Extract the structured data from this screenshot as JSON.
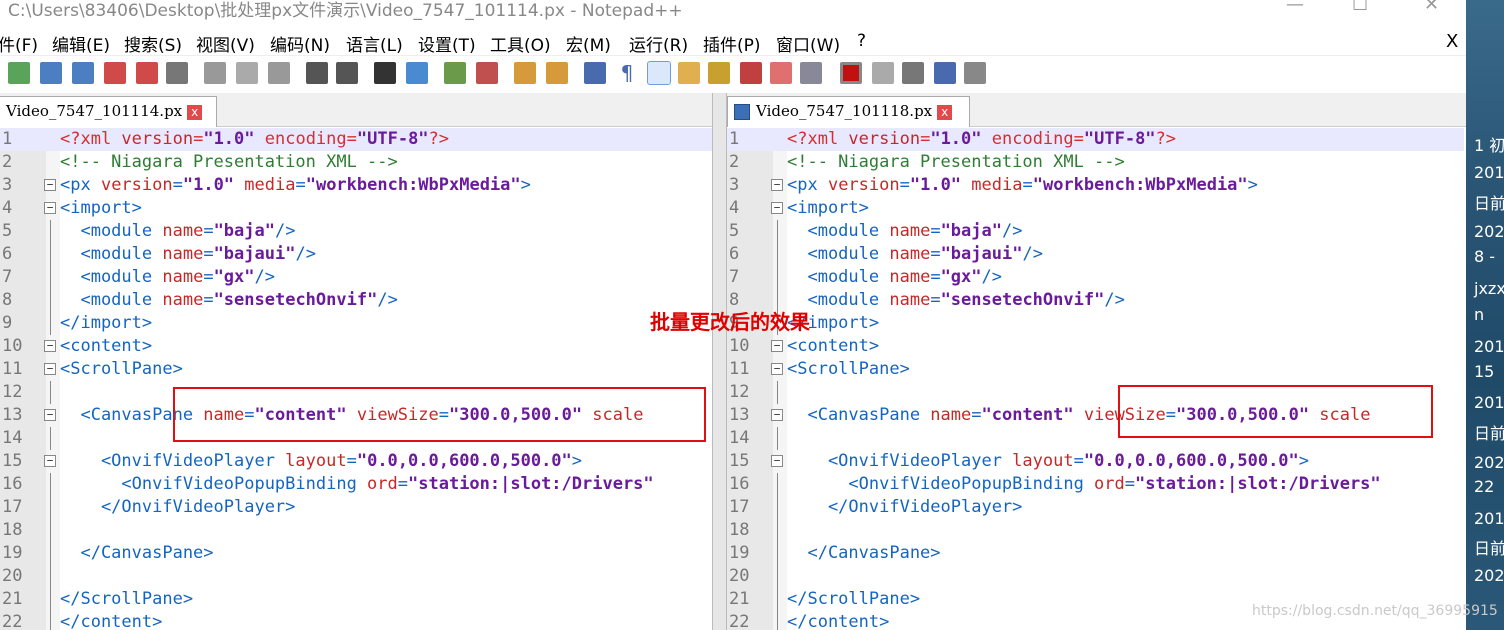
{
  "window": {
    "title": "C:\\Users\\83406\\Desktop\\批处理px文件演示\\Video_7547_101114.px - Notepad++",
    "minimize": "—",
    "maximize": "☐",
    "close": "✕"
  },
  "menu": {
    "items": [
      "件(F)",
      "编辑(E)",
      "搜索(S)",
      "视图(V)",
      "编码(N)",
      "语言(L)",
      "设置(T)",
      "工具(O)",
      "宏(M)",
      "运行(R)",
      "插件(P)",
      "窗口(W)",
      "?"
    ],
    "close": "X"
  },
  "tabs": {
    "left": "Video_7547_101114.px",
    "right": "Video_7547_101118.px",
    "close": "x"
  },
  "editor": {
    "line_numbers": [
      "1",
      "2",
      "3",
      "4",
      "5",
      "6",
      "7",
      "8",
      "9",
      "10",
      "11",
      "12",
      "13",
      "14",
      "15",
      "16",
      "17",
      "18",
      "19",
      "20",
      "21",
      "22"
    ],
    "lines": [
      [
        {
          "t": "pi",
          "s": "<?xml "
        },
        {
          "t": "attr",
          "s": "version"
        },
        {
          "t": "pi",
          "s": "="
        },
        {
          "t": "val",
          "s": "\"1.0\""
        },
        {
          "t": "pi",
          "s": " encoding"
        },
        {
          "t": "pi",
          "s": "="
        },
        {
          "t": "val",
          "s": "\"UTF-8\""
        },
        {
          "t": "pi",
          "s": "?>"
        }
      ],
      [
        {
          "t": "cm",
          "s": "<!-- Niagara Presentation XML -->"
        }
      ],
      [
        {
          "t": "tag",
          "s": "<px "
        },
        {
          "t": "attr",
          "s": "version"
        },
        {
          "t": "tag",
          "s": "="
        },
        {
          "t": "val",
          "s": "\"1.0\""
        },
        {
          "t": "attr",
          "s": " media"
        },
        {
          "t": "tag",
          "s": "="
        },
        {
          "t": "val",
          "s": "\"workbench:WbPxMedia\""
        },
        {
          "t": "tag",
          "s": ">"
        }
      ],
      [
        {
          "t": "tag",
          "s": "<import>"
        }
      ],
      [
        {
          "t": "tag",
          "s": "  <module "
        },
        {
          "t": "attr",
          "s": "name"
        },
        {
          "t": "tag",
          "s": "="
        },
        {
          "t": "val",
          "s": "\"baja\""
        },
        {
          "t": "tag",
          "s": "/>"
        }
      ],
      [
        {
          "t": "tag",
          "s": "  <module "
        },
        {
          "t": "attr",
          "s": "name"
        },
        {
          "t": "tag",
          "s": "="
        },
        {
          "t": "val",
          "s": "\"bajaui\""
        },
        {
          "t": "tag",
          "s": "/>"
        }
      ],
      [
        {
          "t": "tag",
          "s": "  <module "
        },
        {
          "t": "attr",
          "s": "name"
        },
        {
          "t": "tag",
          "s": "="
        },
        {
          "t": "val",
          "s": "\"gx\""
        },
        {
          "t": "tag",
          "s": "/>"
        }
      ],
      [
        {
          "t": "tag",
          "s": "  <module "
        },
        {
          "t": "attr",
          "s": "name"
        },
        {
          "t": "tag",
          "s": "="
        },
        {
          "t": "val",
          "s": "\"sensetechOnvif\""
        },
        {
          "t": "tag",
          "s": "/>"
        }
      ],
      [
        {
          "t": "tag",
          "s": "</import>"
        }
      ],
      [
        {
          "t": "tag",
          "s": "<content>"
        }
      ],
      [
        {
          "t": "tag",
          "s": "<ScrollPane>"
        }
      ],
      [],
      [
        {
          "t": "tag",
          "s": "  <CanvasPane "
        },
        {
          "t": "attr",
          "s": "name"
        },
        {
          "t": "tag",
          "s": "="
        },
        {
          "t": "val",
          "s": "\"content\""
        },
        {
          "t": "attr",
          "s": " viewSize"
        },
        {
          "t": "tag",
          "s": "="
        },
        {
          "t": "val",
          "s": "\"300.0,500.0\""
        },
        {
          "t": "attr",
          "s": " scale"
        }
      ],
      [],
      [
        {
          "t": "tag",
          "s": "    <OnvifVideoPlayer "
        },
        {
          "t": "attr",
          "s": "layout"
        },
        {
          "t": "tag",
          "s": "="
        },
        {
          "t": "val",
          "s": "\"0.0,0.0,600.0,500.0\""
        },
        {
          "t": "tag",
          "s": ">"
        }
      ],
      [
        {
          "t": "tag",
          "s": "      <OnvifVideoPopupBinding "
        },
        {
          "t": "attr",
          "s": "ord"
        },
        {
          "t": "tag",
          "s": "="
        },
        {
          "t": "val",
          "s": "\"station:|slot:/Drivers\""
        }
      ],
      [
        {
          "t": "tag",
          "s": "    </OnvifVideoPlayer>"
        }
      ],
      [],
      [
        {
          "t": "tag",
          "s": "  </CanvasPane>"
        }
      ],
      [],
      [
        {
          "t": "tag",
          "s": "</ScrollPane>"
        }
      ],
      [
        {
          "t": "tag",
          "s": "</content>"
        }
      ]
    ]
  },
  "annotation": "批量更改后的效果",
  "sidebar": {
    "texts": [
      "1 初",
      "201",
      "日前",
      "202",
      "8 -",
      "jxzx",
      "n",
      "201",
      "15",
      "201",
      "日前",
      "202",
      "22",
      "201",
      "日前",
      "202"
    ]
  },
  "watermark": "https://blog.csdn.net/qq_36995915"
}
